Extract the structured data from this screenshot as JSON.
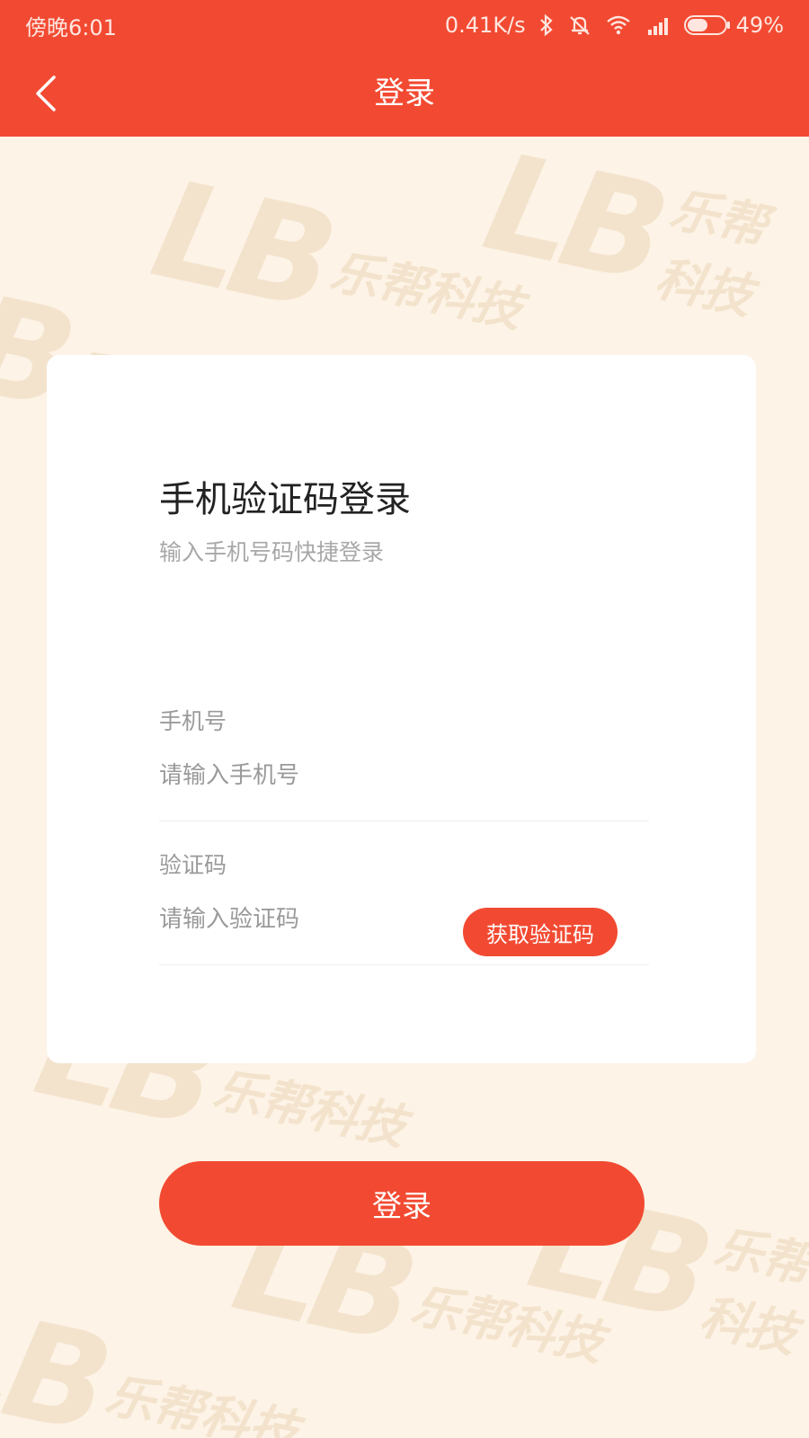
{
  "status_bar": {
    "time": "傍晚6:01",
    "network_speed": "0.41K/s",
    "battery": "49%",
    "icons": [
      "bluetooth-icon",
      "mute-icon",
      "wifi-icon",
      "signal-icon",
      "battery-icon"
    ]
  },
  "nav": {
    "title": "登录",
    "back_icon": "chevron-left-icon"
  },
  "card": {
    "title": "手机验证码登录",
    "subtitle": "输入手机号码快捷登录",
    "phone": {
      "label": "手机号",
      "placeholder": "请输入手机号",
      "value": ""
    },
    "code": {
      "label": "验证码",
      "placeholder": "请输入验证码",
      "value": "",
      "button_label": "获取验证码"
    }
  },
  "login_button": "登录",
  "watermark": {
    "logo": "LB",
    "text": "乐帮科技"
  },
  "colors": {
    "accent": "#F24A32",
    "background": "#FDF3E6",
    "card": "#FFFFFF"
  }
}
